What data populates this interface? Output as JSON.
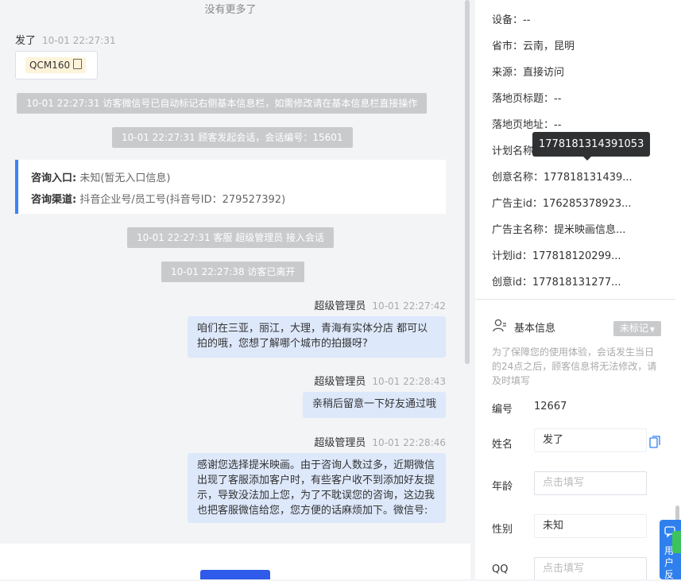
{
  "chat": {
    "no_more": "没有更多了",
    "first_sender": {
      "name": "发了",
      "time": "10-01 22:27:31"
    },
    "code_chip": "QCM160",
    "system_messages": [
      "10-01 22:27:31 访客微信号已自动标记右侧基本信息栏，如需修改请在基本信息栏直接操作",
      "10-01 22:27:31 顾客发起会话，会话编号：15601",
      "10-01 22:27:31 客服 超级管理员 接入会话",
      "10-01 22:27:38 访客已离开"
    ],
    "info_card": {
      "entry_label": "咨询入口:",
      "entry_value": "未知(暂无入口信息)",
      "channel_label": "咨询渠道:",
      "channel_value": "抖音企业号/员工号(抖音号ID：279527392)"
    },
    "agent_messages": [
      {
        "name": "超级管理员",
        "time": "10-01 22:27:42",
        "line1": "咱们在三亚，丽江，大理，青海有实体分店 都可以",
        "line2": "拍的哦，您想了解哪个城市的拍摄呀?"
      },
      {
        "name": "超级管理员",
        "time": "10-01 22:28:43",
        "line1": "亲稍后留意一下好友通过哦"
      },
      {
        "name": "超级管理员",
        "time": "10-01 22:28:46",
        "line1": "感谢您选择提米映画。由于咨询人数过多，近期微信",
        "line2": "出现了客服添加客户时，有些客户收不到添加好友提",
        "line3": "示，导致没法加上您，为了不耽误您的咨询，这边我",
        "line4": "也把客服微信给您，您方便的话麻烦加下。微信号:"
      }
    ]
  },
  "panel": {
    "device": "设备：--",
    "province_city": "省市：云南，昆明",
    "source": "来源：直接访问",
    "landing_title": "落地页标题：--",
    "landing_url": "落地页地址：--",
    "plan_name": "计划名称：",
    "creative_name": "创意名称：177818131439...",
    "advertiser_id": "广告主id：176285378923...",
    "advertiser_name": "广告主名称：提米映画信息...",
    "plan_id": "计划id：177818120299...",
    "creative_id": "创意id：177818131277...",
    "tooltip": "1778181314391053",
    "basic_info_title": "基本信息",
    "tag_button": "未标记",
    "notice": "为了保障您的使用体验，会话发生当日的24点之后，顾客信息将无法修改，请及时填写",
    "fields": {
      "id_label": "编号",
      "id_value": "12667",
      "name_label": "姓名",
      "name_value": "发了",
      "age_label": "年龄",
      "age_placeholder": "点击填写",
      "gender_label": "性别",
      "gender_value": "未知",
      "qq_label": "QQ",
      "qq_placeholder": "点击填写"
    },
    "feedback": "用户反"
  }
}
